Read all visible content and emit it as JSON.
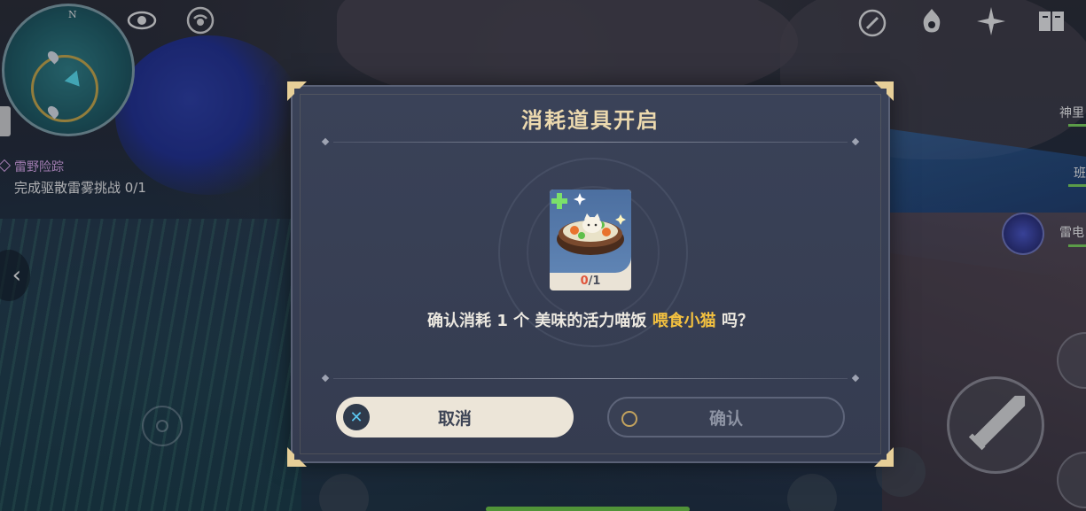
{
  "hud": {
    "minimap_north": "N",
    "quest": {
      "title": "雷野险踪",
      "objective": "完成驱散雷雾挑战 0/1"
    },
    "party": [
      {
        "name": "神里"
      },
      {
        "name": "班"
      },
      {
        "name": "雷电"
      }
    ],
    "top_right_icons": [
      "compass-icon",
      "wish-icon",
      "sparkle-event-icon",
      "adventurer-handbook-icon"
    ],
    "top_left_icons": [
      "eye-icon",
      "signal-icon"
    ]
  },
  "dialog": {
    "title": "消耗道具开启",
    "item": {
      "name": "美味的活力喵饭",
      "owned": "0",
      "required": "1"
    },
    "message": {
      "prefix": "确认消耗",
      "quantity": "1",
      "unit": "个",
      "item_name": "美味的活力喵饭",
      "action": "喂食小猫",
      "suffix": "吗？"
    },
    "buttons": {
      "cancel": "取消",
      "confirm": "确认"
    }
  },
  "colors": {
    "title": "#ecd9ae",
    "highlight": "#f4c13f",
    "owned_count": "#e0553b",
    "dialog_bg": "#383f54"
  }
}
